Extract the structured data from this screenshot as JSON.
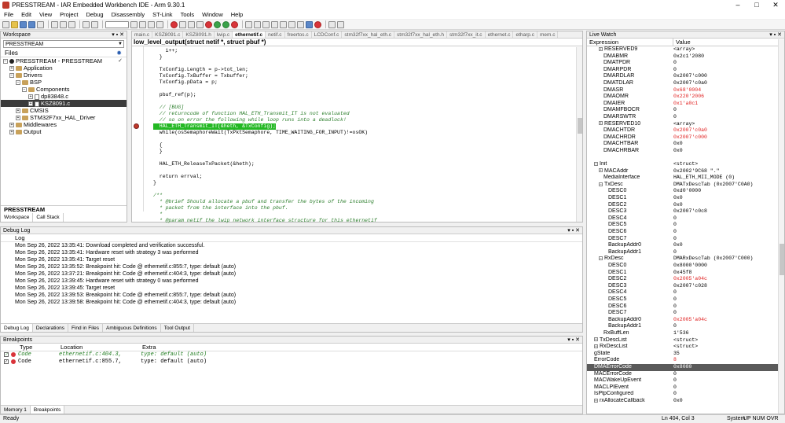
{
  "window": {
    "title": "PRESSTREAM - IAR Embedded Workbench IDE - Arm 9.30.1"
  },
  "menu": [
    "File",
    "Edit",
    "View",
    "Project",
    "Debug",
    "Disassembly",
    "ST-Link",
    "Tools",
    "Window",
    "Help"
  ],
  "workspace": {
    "title": "Workspace",
    "select": "PRESSTREAM",
    "files_header": "Files",
    "tree": [
      {
        "label": "PRESSTREAM - PRESSTREAM",
        "level": 0,
        "kind": "project",
        "exp": "−",
        "check": "✓"
      },
      {
        "label": "Application",
        "level": 1,
        "kind": "folder",
        "exp": "+"
      },
      {
        "label": "Drivers",
        "level": 1,
        "kind": "folder",
        "exp": "−"
      },
      {
        "label": "BSP",
        "level": 2,
        "kind": "folder",
        "exp": "−"
      },
      {
        "label": "Components",
        "level": 3,
        "kind": "folder",
        "exp": "−"
      },
      {
        "label": "dp83848.c",
        "level": 4,
        "kind": "file",
        "exp": "+"
      },
      {
        "label": "KSZ8091.c",
        "level": 4,
        "kind": "file",
        "exp": "+",
        "selected": true
      },
      {
        "label": "CMSIS",
        "level": 2,
        "kind": "folder",
        "exp": "+"
      },
      {
        "label": "STM32F7xx_HAL_Driver",
        "level": 2,
        "kind": "folder",
        "exp": "+"
      },
      {
        "label": "Middlewares",
        "level": 1,
        "kind": "folder",
        "exp": "+"
      },
      {
        "label": "Output",
        "level": 1,
        "kind": "folder",
        "exp": "+"
      }
    ],
    "footer": "PRESSTREAM",
    "tabs": [
      "Workspace",
      "Call Stack"
    ]
  },
  "editor": {
    "tabs": [
      "main.c",
      "KSZ8091.c",
      "KSZ8091.h",
      "lwip.c",
      "ethernetif.c",
      "netif.c",
      "freertos.c",
      "LCDConf.c",
      "stm32f7xx_hal_eth.c",
      "stm32f7xx_hal_eth.h",
      "stm32f7xx_it.c",
      "ethernet.c",
      "etharp.c",
      "mem.c"
    ],
    "active_tab": "ethernetif.c",
    "function": "low_level_output(struct netif *, struct pbuf *)",
    "lines": [
      "    i++;",
      "  }",
      "",
      "  TxConfig.Length = p->tot_len;",
      "  TxConfig.TxBuffer = Txbuffer;",
      "  TxConfig.pData = p;",
      "",
      "  pbuf_ref(p);",
      "",
      "  // [BUG]",
      "  // returncode of function HAL_ETH_Transmit_IT is not evaluated",
      "  // so on error the following while loop runs into a deadlock!",
      "  HAL_ETH_Transmit_IT(&heth, &TxConfig);",
      "  while(osSemaphoreWait(TxPktSemaphore, TIME_WAITING_FOR_INPUT)!=osOK)",
      "",
      "  {",
      "  }",
      "",
      "  HAL_ETH_ReleaseTxPacket(&heth);",
      "",
      "  return errval;",
      "}",
      "",
      "/**",
      "  * @brief Should allocate a pbuf and transfer the bytes of the incoming",
      "  * packet from the interface into the pbuf.",
      "  *",
      "  * @param netif the lwip network interface structure for this ethernetif"
    ]
  },
  "debug_log": {
    "title": "Debug Log",
    "header": "Log",
    "entries": [
      "Mon Sep 26, 2022 13:35:41: Download completed and verification successful.",
      "Mon Sep 26, 2022 13:35:41: Hardware reset with strategy 3 was performed",
      "Mon Sep 26, 2022 13:35:41: Target reset",
      "Mon Sep 26, 2022 13:35:52: Breakpoint hit: Code @ ethernetif.c:855:7, type: default (auto)",
      "Mon Sep 26, 2022 13:37:21: Breakpoint hit: Code @ ethernetif.c:404:3, type: default (auto)",
      "Mon Sep 26, 2022 13:39:45: Hardware reset with strategy 0 was performed",
      "Mon Sep 26, 2022 13:39:45: Target reset",
      "Mon Sep 26, 2022 13:39:53: Breakpoint hit: Code @ ethernetif.c:855:7, type: default (auto)",
      "Mon Sep 26, 2022 13:39:58: Breakpoint hit: Code @ ethernetif.c:404:3, type: default (auto)"
    ],
    "tabs": [
      "Debug Log",
      "Declarations",
      "Find in Files",
      "Ambiguous Definitions",
      "Tool Output"
    ]
  },
  "breakpoints": {
    "title": "Breakpoints",
    "columns": [
      "Type",
      "Location",
      "Extra"
    ],
    "rows": [
      {
        "type": "Code",
        "location": "ethernetif.c:404.3,",
        "extra": "type: default (auto)"
      },
      {
        "type": "Code",
        "location": "ethernetif.c:855.7,",
        "extra": "type: default (auto)"
      }
    ],
    "tabs": [
      "Memory 1",
      "Breakpoints"
    ]
  },
  "live_watch": {
    "title": "Live Watch",
    "columns": [
      "Expression",
      "Value"
    ],
    "rows": [
      {
        "name": "RESERVED9",
        "value": "<array>",
        "indent": 2,
        "exp": "+"
      },
      {
        "name": "DMABMR",
        "value": "0x2c1'2080",
        "indent": 3
      },
      {
        "name": "DMATPDR",
        "value": "0",
        "indent": 3
      },
      {
        "name": "DMARPDR",
        "value": "0",
        "indent": 3
      },
      {
        "name": "DMARDLAR",
        "value": "0x2007'c000",
        "indent": 3
      },
      {
        "name": "DMATDLAR",
        "value": "0x2007'c0a0",
        "indent": 3
      },
      {
        "name": "DMASR",
        "value": "0x68'0004",
        "indent": 3,
        "red": true
      },
      {
        "name": "DMAOMR",
        "value": "0x220'2006",
        "indent": 3,
        "red": true
      },
      {
        "name": "DMAIER",
        "value": "0x1'a0c1",
        "indent": 3,
        "red": true
      },
      {
        "name": "DMAMFBOCR",
        "value": "0",
        "indent": 3
      },
      {
        "name": "DMARSWTR",
        "value": "0",
        "indent": 3
      },
      {
        "name": "RESERVED10",
        "value": "<array>",
        "indent": 2,
        "exp": "+"
      },
      {
        "name": "DMACHTDR",
        "value": "0x2007'c0a0",
        "indent": 3,
        "red": true
      },
      {
        "name": "DMACHRDR",
        "value": "0x2007'c000",
        "indent": 3,
        "red": true
      },
      {
        "name": "DMACHTBAR",
        "value": "0x0",
        "indent": 3
      },
      {
        "name": "DMACHRBAR",
        "value": "0x0",
        "indent": 3
      },
      {
        "name": "",
        "value": "",
        "indent": 0
      },
      {
        "name": "Init",
        "value": "<struct>",
        "indent": 1,
        "exp": "−"
      },
      {
        "name": "MACAddr",
        "value": "0x2002'9C68 \".\"",
        "indent": 2,
        "exp": "+"
      },
      {
        "name": "MediaInterface",
        "value": "HAL_ETH_MII_MODE (0)",
        "indent": 3
      },
      {
        "name": "TxDesc",
        "value": "DMATxDescTab (0x2007'C0A0)",
        "indent": 2,
        "exp": "−"
      },
      {
        "name": "DESC0",
        "value": "0xd0'0000",
        "indent": 4
      },
      {
        "name": "DESC1",
        "value": "0x0",
        "indent": 4
      },
      {
        "name": "DESC2",
        "value": "0x0",
        "indent": 4
      },
      {
        "name": "DESC3",
        "value": "0x2007'c0c8",
        "indent": 4
      },
      {
        "name": "DESC4",
        "value": "0",
        "indent": 4
      },
      {
        "name": "DESC5",
        "value": "0",
        "indent": 4
      },
      {
        "name": "DESC6",
        "value": "0",
        "indent": 4
      },
      {
        "name": "DESC7",
        "value": "0",
        "indent": 4
      },
      {
        "name": "BackupAddr0",
        "value": "0x0",
        "indent": 4
      },
      {
        "name": "BackupAddr1",
        "value": "0",
        "indent": 4
      },
      {
        "name": "RxDesc",
        "value": "DMARxDescTab (0x2007'C000)",
        "indent": 2,
        "exp": "−"
      },
      {
        "name": "DESC0",
        "value": "0x8000'0000",
        "indent": 4
      },
      {
        "name": "DESC1",
        "value": "0x45f8",
        "indent": 4
      },
      {
        "name": "DESC2",
        "value": "0x2005'a04c",
        "indent": 4,
        "red": true
      },
      {
        "name": "DESC3",
        "value": "0x2007'c028",
        "indent": 4
      },
      {
        "name": "DESC4",
        "value": "0",
        "indent": 4
      },
      {
        "name": "DESC5",
        "value": "0",
        "indent": 4
      },
      {
        "name": "DESC6",
        "value": "0",
        "indent": 4
      },
      {
        "name": "DESC7",
        "value": "0",
        "indent": 4
      },
      {
        "name": "BackupAddr0",
        "value": "0x2005'a04c",
        "indent": 4,
        "red": true
      },
      {
        "name": "BackupAddr1",
        "value": "0",
        "indent": 4
      },
      {
        "name": "RxBuffLen",
        "value": "1'536",
        "indent": 3
      },
      {
        "name": "TxDescList",
        "value": "<struct>",
        "indent": 1,
        "exp": "+"
      },
      {
        "name": "RxDescList",
        "value": "<struct>",
        "indent": 1,
        "exp": "+"
      },
      {
        "name": "gState",
        "value": "35",
        "indent": 1
      },
      {
        "name": "ErrorCode",
        "value": "8",
        "indent": 1,
        "red": true
      },
      {
        "name": "DMAErrorCode",
        "value": "0x8080",
        "indent": 1,
        "selected": true
      },
      {
        "name": "MACErrorCode",
        "value": "0",
        "indent": 1
      },
      {
        "name": "MACWakeUpEvent",
        "value": "0",
        "indent": 1
      },
      {
        "name": "MACLPIEvent",
        "value": "0",
        "indent": 1
      },
      {
        "name": "IsPtpConfigured",
        "value": "0",
        "indent": 1
      },
      {
        "name": "rxAllocateCallback",
        "value": "0x0",
        "indent": 1,
        "exp": "+"
      }
    ]
  },
  "status": {
    "left": "Ready",
    "position": "Ln 404, Col 3",
    "system": "System",
    "flags": "UP NUM OVR"
  }
}
